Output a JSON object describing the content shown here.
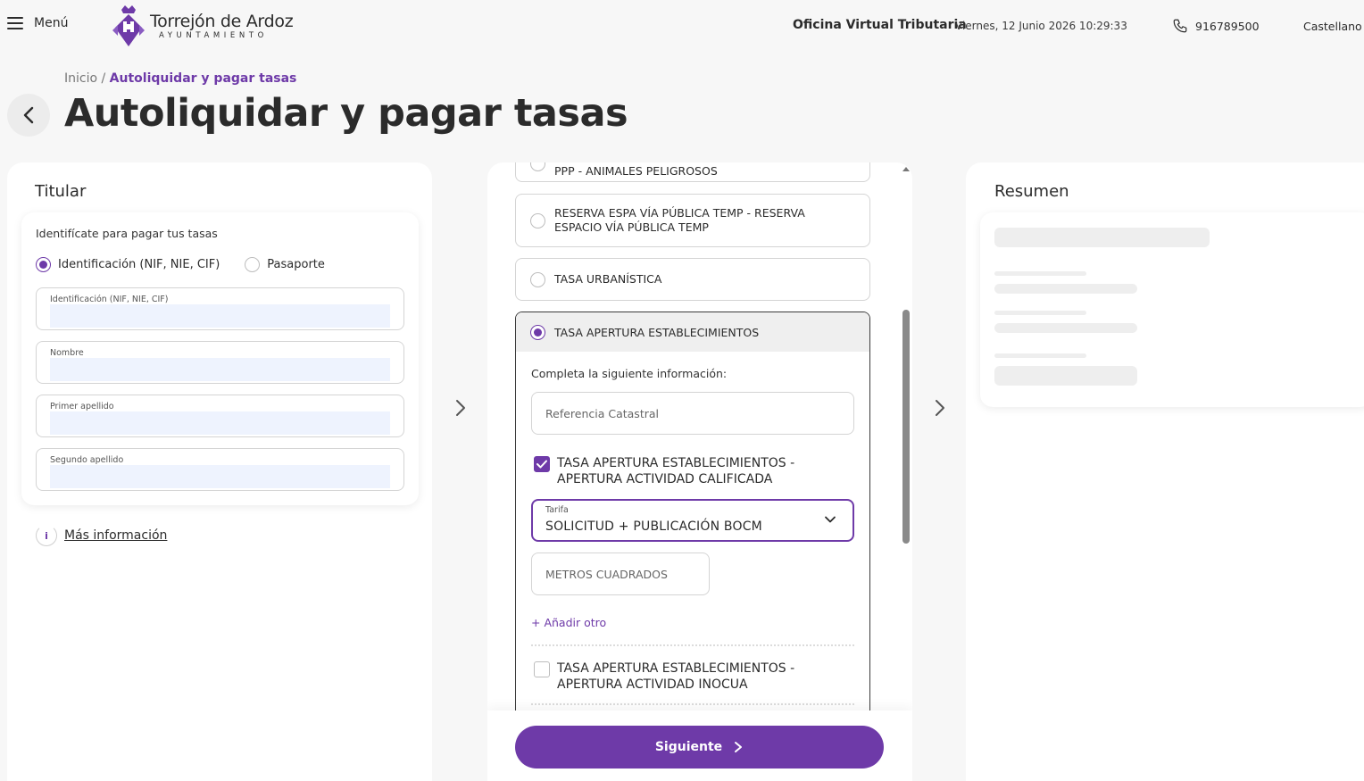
{
  "header": {
    "menu_label": "Menú",
    "logo_name": "Torrejón de Ardoz",
    "logo_sub": "AYUNTAMIENTO",
    "office": "Oficina Virtual Tributaria",
    "datetime": "Viernes, 12 Junio 2026 10:29:33",
    "phone": "916789500",
    "language": "Castellano"
  },
  "breadcrumb": {
    "home": "Inicio",
    "separator": "/",
    "current": "Autoliquidar y pagar tasas"
  },
  "page_title": "Autoliquidar y pagar tasas",
  "titular": {
    "title": "Titular",
    "intro": "Identifícate para pagar tus tasas",
    "id_types": [
      {
        "label": "Identificación (NIF, NIE, CIF)",
        "selected": true
      },
      {
        "label": "Pasaporte",
        "selected": false
      }
    ],
    "fields": [
      {
        "label": "Identificación (NIF, NIE, CIF)"
      },
      {
        "label": "Nombre"
      },
      {
        "label": "Primer apellido"
      },
      {
        "label": "Segundo apellido"
      }
    ],
    "more_info": "Más información",
    "info_icon_char": "i"
  },
  "tasas": {
    "options": [
      {
        "label": "PPP - ANIMALES PELIGROSOS",
        "selected": false
      },
      {
        "label": "RESERVA ESPA VÍA PÚBLICA TEMP - RESERVA ESPACIO VÍA PÚBLICA TEMP",
        "selected": false
      },
      {
        "label": "TASA URBANÍSTICA",
        "selected": false
      },
      {
        "label": "TASA APERTURA ESTABLECIMIENTOS",
        "selected": true
      }
    ],
    "complete_info": "Completa la siguiente información:",
    "catastral_placeholder": "Referencia Catastral",
    "sub_items": [
      {
        "label": "TASA APERTURA ESTABLECIMIENTOS - APERTURA ACTIVIDAD CALIFICADA",
        "checked": true
      },
      {
        "label": "TASA APERTURA ESTABLECIMIENTOS - APERTURA ACTIVIDAD INOCUA",
        "checked": false
      }
    ],
    "tarifa_label": "Tarifa",
    "tarifa_value": "SOLICITUD + PUBLICACIÓN BOCM",
    "metros_placeholder": "METROS CUADRADOS",
    "add_other": "+ Añadir otro",
    "next_button": "Siguiente"
  },
  "resumen": {
    "title": "Resumen"
  },
  "colors": {
    "accent": "#6e3aa8",
    "background": "#f7f7f7",
    "field_fill": "#eef3fe"
  },
  "icons": [
    "hamburger-icon",
    "phone-icon",
    "chevron-left-icon",
    "chevron-right-icon",
    "chevron-down-icon",
    "check-icon",
    "info-icon"
  ]
}
